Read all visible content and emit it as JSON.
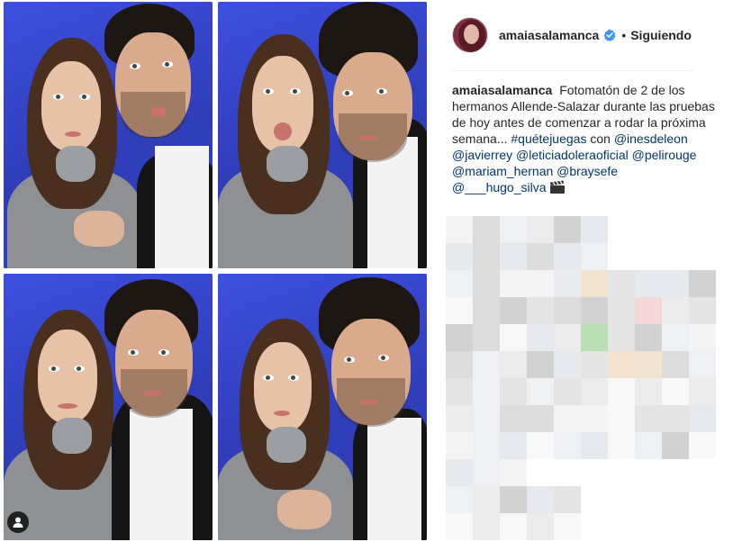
{
  "post": {
    "username": "amaiasalamanca",
    "follow_status": "Siguiendo",
    "separator": "•",
    "caption": {
      "author": "amaiasalamanca",
      "text": "Fotomatón de 2 de los hermanos Allende-Salazar durante las pruebas de hoy antes de comenzar a rodar la próxima semana...",
      "hashtag": "#quétejuegas",
      "connector": "con",
      "mentions": [
        "@inesdeleon",
        "@javierrey",
        "@leticiadoleraoficial",
        "@pelirouge",
        "@mariam_hernan",
        "@braysefe",
        "@___hugo_silva"
      ]
    }
  },
  "icons": {
    "verified": "verified-badge-icon",
    "user_tag": "person-icon",
    "clapper": "clapper-board-icon"
  },
  "colors": {
    "verified_blue": "#3897f0",
    "link": "#003569",
    "photo_background": "#3a47c8"
  }
}
